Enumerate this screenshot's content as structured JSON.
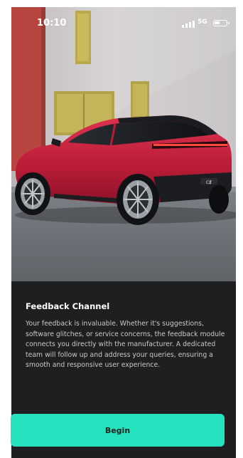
{
  "status_bar": {
    "time": "10:10",
    "network": "5G",
    "signal_icon": "signal-bars-icon",
    "battery_icon": "battery-icon"
  },
  "hero": {
    "image": "red-suv-photo",
    "vehicle_badge": "CɆ"
  },
  "feedback": {
    "title": "Feedback Channel",
    "description": "Your feedback is invaluable. Whether it's suggestions, software glitches, or service concerns, the feedback module connects you directly with the manufacturer. A dedicated team will follow up and address your queries, ensuring a smooth and responsive user experience."
  },
  "actions": {
    "begin_label": "Begin"
  },
  "colors": {
    "background": "#1f1f21",
    "accent": "#27e2bf",
    "car": "#c8203a",
    "text_primary": "#ffffff",
    "text_secondary": "#c9c9cc"
  }
}
